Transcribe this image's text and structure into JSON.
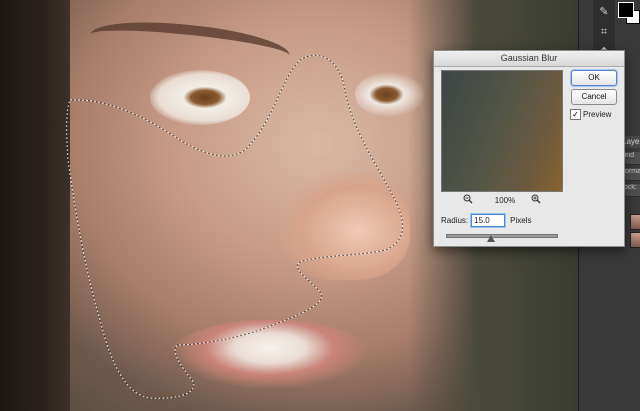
{
  "dialog": {
    "title": "Gaussian Blur",
    "ok_label": "OK",
    "cancel_label": "Cancel",
    "preview_label": "Preview",
    "preview_checked": "✓",
    "zoom_level": "100%",
    "radius_label": "Radius:",
    "radius_value": "15.0",
    "radius_unit": "Pixels"
  },
  "panel": {
    "layers_tab": "Layers",
    "layers_rows": [
      "Kind",
      "Normal",
      "Lock:"
    ]
  },
  "icons": {
    "zoom_out": "zoom-out-icon",
    "zoom_in": "zoom-in-icon",
    "slider": "slider-thumb-icon"
  },
  "colors": {
    "foreground_swatch": "#000000",
    "background_swatch": "#ffffff",
    "ok_focus": "#5a83c9"
  }
}
